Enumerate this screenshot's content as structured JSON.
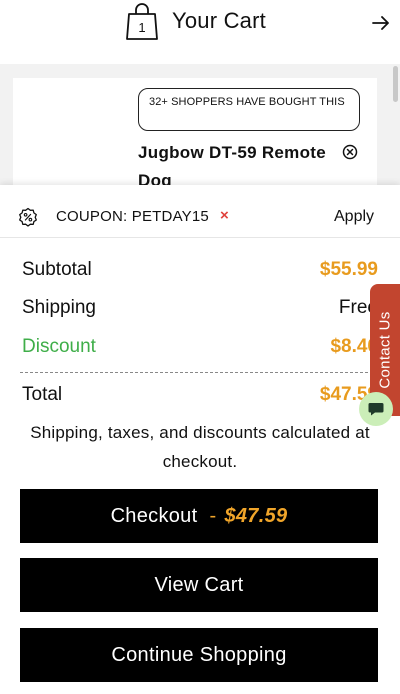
{
  "header": {
    "bag_count": "1",
    "title": "Your Cart",
    "icons": {
      "bag": "shopping-bag-icon",
      "next": "arrow-right-icon"
    }
  },
  "item": {
    "badge": "32+ SHOPPERS HAVE BOUGHT THIS",
    "name": "Jugbow DT-59 Remote Dog",
    "remove_icon": "close-circle-icon"
  },
  "coupon": {
    "icon": "percent-badge-icon",
    "label": "COUPON: PETDAY15",
    "remove": "×",
    "apply": "Apply"
  },
  "summary": {
    "subtotal_label": "Subtotal",
    "subtotal_value": "$55.99",
    "shipping_label": "Shipping",
    "shipping_value": "Free",
    "discount_label": "Discount",
    "discount_value": "$8.40",
    "total_label": "Total",
    "total_value": "$47.59",
    "note": "Shipping, taxes, and discounts calculated at checkout."
  },
  "buttons": {
    "checkout_label": "Checkout",
    "checkout_sep": "-",
    "checkout_price": "$47.59",
    "view_cart": "View Cart",
    "continue": "Continue Shopping"
  },
  "contact": {
    "label": "Contact Us",
    "chat_icon": "chat-bubble-icon"
  },
  "colors": {
    "accent_orange": "#e89b1e",
    "discount_green": "#3fae49",
    "coupon_remove_red": "#e0413b",
    "contact_tab": "#c2452f",
    "button_bg": "#000000"
  }
}
